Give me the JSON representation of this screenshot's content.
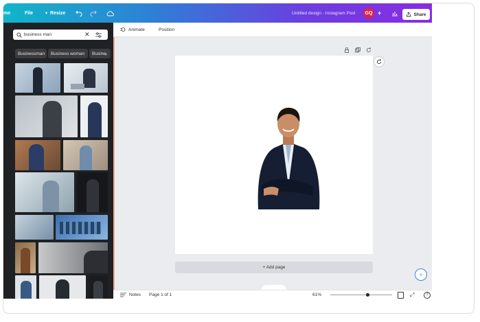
{
  "topbar": {
    "home_label": "me",
    "file_label": "File",
    "resize_label": "Resize",
    "doc_title": "Untitled design - Instagram Post",
    "avatar_initials": "GQ",
    "share_label": "Share",
    "gradient_colors": [
      "#10b6c9",
      "#8a2be2"
    ]
  },
  "panel": {
    "search_value": "business man",
    "chips": [
      "Businessman",
      "Business woman",
      "Busine"
    ]
  },
  "context_bar": {
    "animate_label": "Animate",
    "position_label": "Position"
  },
  "canvas": {
    "add_page_label": "+ Add page"
  },
  "statusbar": {
    "notes_label": "Notes",
    "page_label": "Page 1 of 1",
    "zoom_label": "61%",
    "zoom_fraction": 0.61
  },
  "colors": {
    "accent": "#8a2be2",
    "panel_bg": "#1f2124",
    "selection": "#f0a98c"
  }
}
